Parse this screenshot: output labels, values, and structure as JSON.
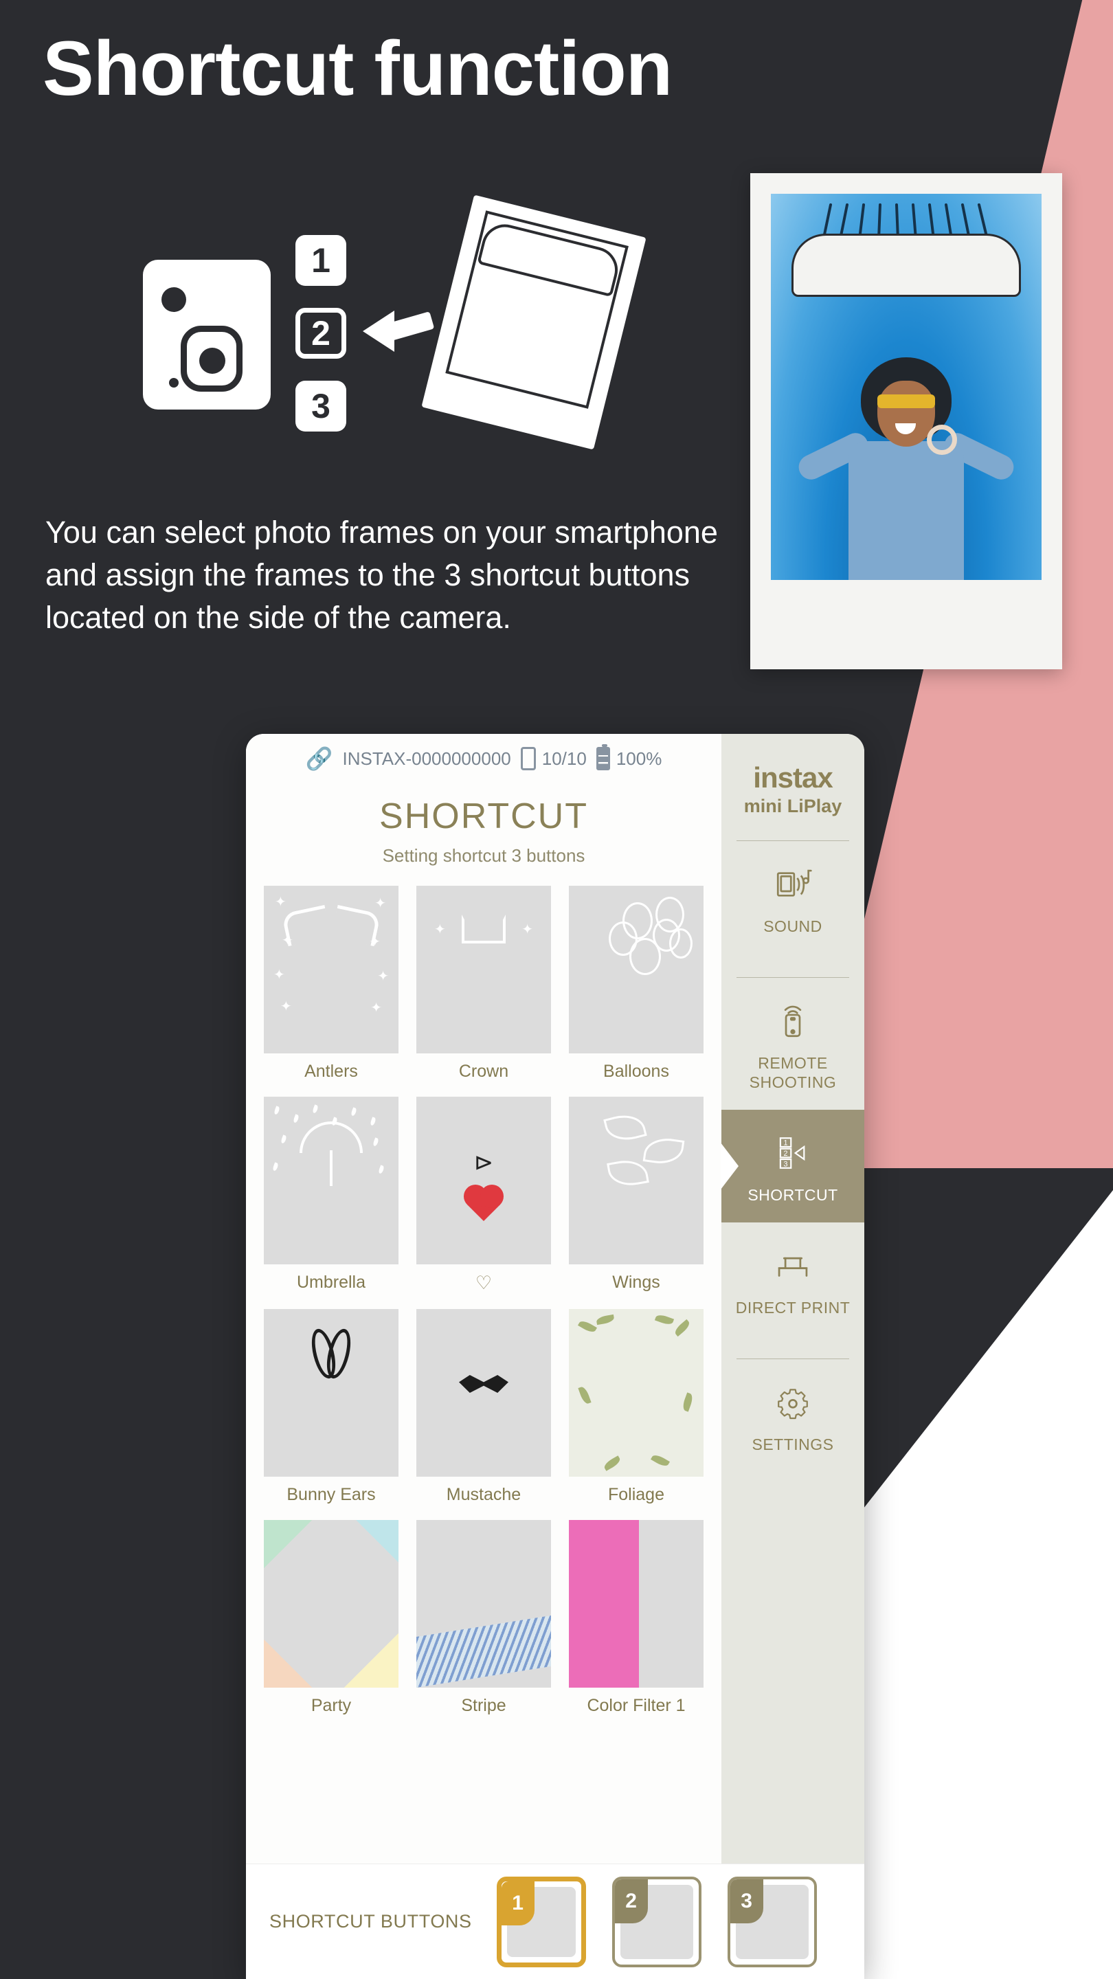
{
  "hero": {
    "title": "Shortcut function",
    "body": "You can select photo frames on your smartphone and assign the frames to the 3 shortcut buttons located on the side of the camera.",
    "step_numbers": [
      "1",
      "2",
      "3"
    ]
  },
  "colors": {
    "background_dark": "#2b2c30",
    "accent_pink": "#e8a3a3",
    "brand_gold": "#8a8157",
    "active_olive": "#9c9478",
    "active_gold": "#d9a430",
    "sidebar_bg": "#e6e7e0"
  },
  "app": {
    "statusbar": {
      "bluetooth_icon": "bluetooth-icon",
      "device_name": "INSTAX-0000000000",
      "film_icon": "film-count-icon",
      "film_count": "10/10",
      "battery_icon": "battery-icon",
      "battery_level": "100%"
    },
    "title": "SHORTCUT",
    "subtitle": "Setting shortcut 3 buttons",
    "brand": {
      "line1": "instax",
      "line2": "mini LiPlay"
    },
    "sidebar": [
      {
        "label": "SOUND",
        "icon": "sound-icon",
        "active": false
      },
      {
        "label": "REMOTE SHOOTING",
        "icon": "remote-shooting-icon",
        "active": false
      },
      {
        "label": "SHORTCUT",
        "icon": "shortcut-123-icon",
        "active": true
      },
      {
        "label": "DIRECT PRINT",
        "icon": "direct-print-icon",
        "active": false
      },
      {
        "label": "SETTINGS",
        "icon": "gear-icon",
        "active": false
      }
    ],
    "frames": [
      {
        "label": "Antlers",
        "style": "antlers"
      },
      {
        "label": "Crown",
        "style": "crown"
      },
      {
        "label": "Balloons",
        "style": "balloons"
      },
      {
        "label": "Umbrella",
        "style": "umbrella"
      },
      {
        "label": "♡",
        "style": "heart"
      },
      {
        "label": "Wings",
        "style": "wings"
      },
      {
        "label": "Bunny Ears",
        "style": "bunny"
      },
      {
        "label": "Mustache",
        "style": "mustache"
      },
      {
        "label": "Foliage",
        "style": "foliage"
      },
      {
        "label": "Party",
        "style": "party"
      },
      {
        "label": "Stripe",
        "style": "stripe"
      },
      {
        "label": "Color Filter 1",
        "style": "colorfilter"
      }
    ],
    "shortcut_bar": {
      "title": "SHORTCUT BUTTONS",
      "buttons": [
        {
          "number": "1",
          "active": true
        },
        {
          "number": "2",
          "active": false
        },
        {
          "number": "3",
          "active": false
        }
      ]
    }
  }
}
